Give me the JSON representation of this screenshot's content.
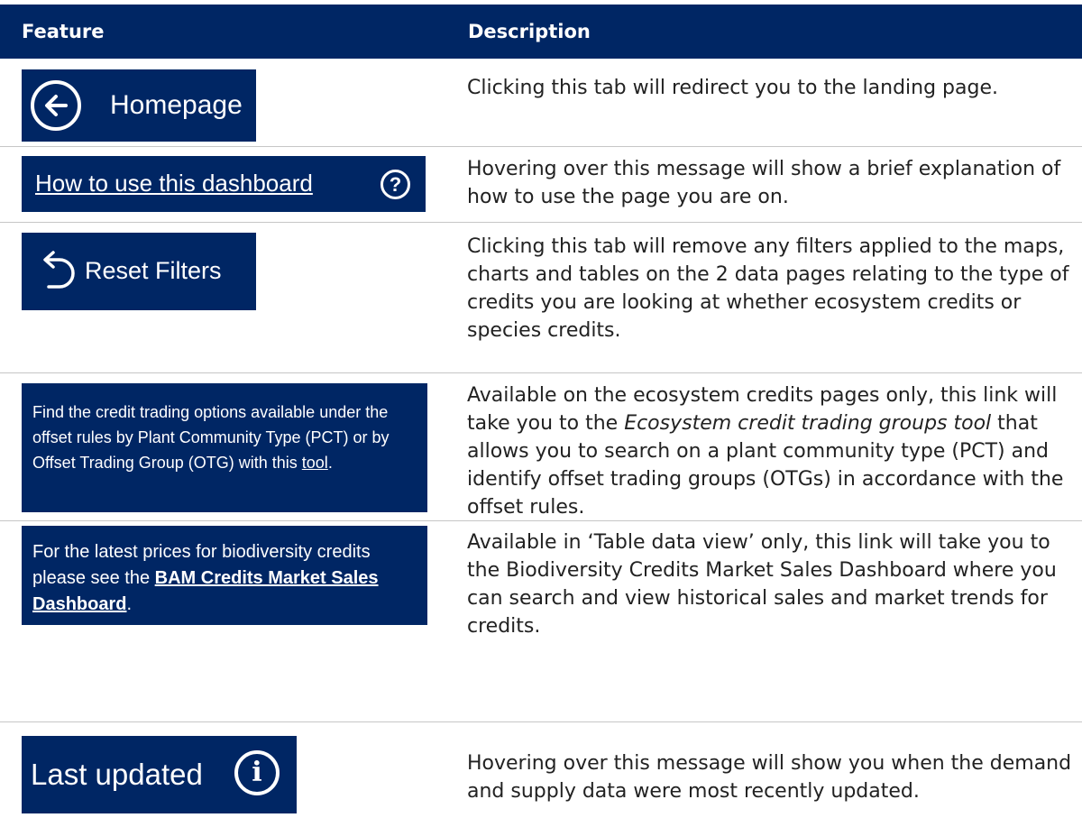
{
  "header": {
    "feature_label": "Feature",
    "description_label": "Description"
  },
  "rows": [
    {
      "feature": {
        "label": "Homepage",
        "icon": "arrow-left-circle-icon"
      },
      "description": "Clicking this tab will redirect you to the landing page."
    },
    {
      "feature": {
        "label": "How to use this dashboard",
        "icon": "question-circle-icon",
        "icon_text": "?"
      },
      "description": "Hovering over this message will show a brief explanation of how to use the page you are on."
    },
    {
      "feature": {
        "label": "Reset Filters",
        "icon": "undo-arrow-icon"
      },
      "description": "Clicking this tab will remove any filters applied to the maps, charts and tables on the 2 data pages relating to the type of credits you are looking at whether ecosystem credits or species credits."
    },
    {
      "feature": {
        "text_before_link": "Find the credit trading options available under the offset rules by Plant Community Type (PCT) or by Offset Trading Group (OTG) with this ",
        "link": "tool",
        "text_after_link": "."
      },
      "description_before": "Available on the ecosystem credits pages only, this link will take you to the ",
      "description_em": "Ecosystem credit trading groups tool",
      "description_after": " that allows you to search on a plant community type (PCT) and identify offset trading groups (OTGs) in accordance with the offset rules."
    },
    {
      "feature": {
        "text_before_link": "For the latest prices for biodiversity credits please see the ",
        "link": "BAM Credits Market Sales Dashboard",
        "text_after_link": "."
      },
      "description": "Available in ‘Table data view’ only, this link will take you to the Biodiversity Credits Market Sales Dashboard where you can search and view historical sales and market trends for credits."
    },
    {
      "feature": {
        "label": "Last updated",
        "icon": "info-circle-icon",
        "icon_text": "i"
      },
      "description": "Hovering over this message will show you when the demand and supply data were most recently updated."
    }
  ],
  "colors": {
    "navy": "#002664",
    "text": "#222222",
    "divider": "#c6c6c6"
  }
}
